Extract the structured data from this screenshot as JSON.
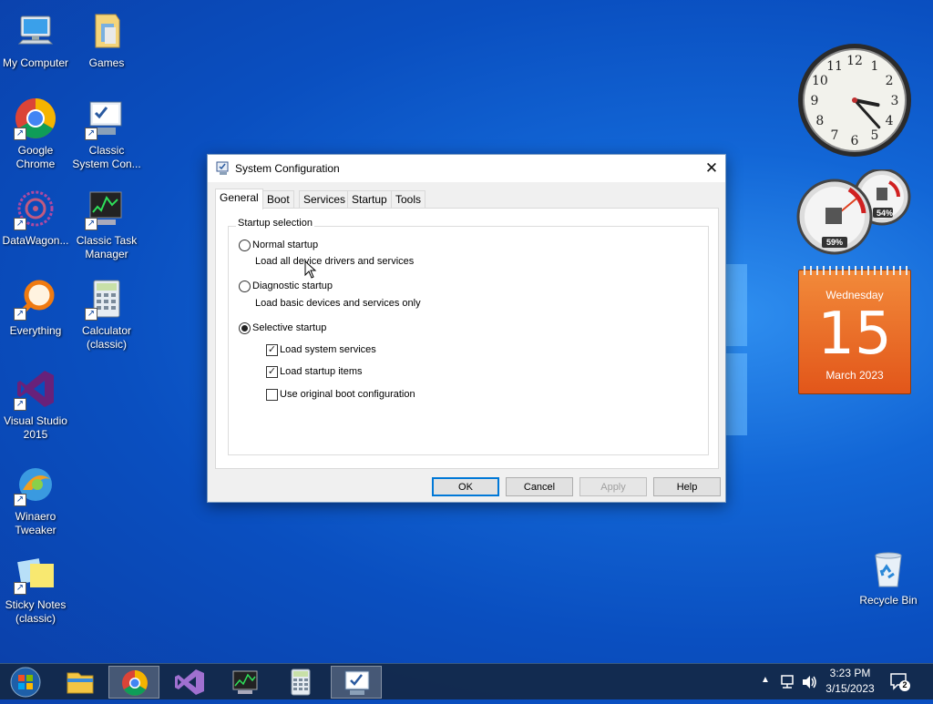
{
  "desktop": {
    "icons": [
      {
        "label": "My Computer"
      },
      {
        "label": "Games"
      },
      {
        "label": "Google Chrome"
      },
      {
        "label": "Classic System Con..."
      },
      {
        "label": "DataWagon..."
      },
      {
        "label": "Classic Task Manager"
      },
      {
        "label": "Everything"
      },
      {
        "label": "Calculator (classic)"
      },
      {
        "label": "Visual Studio 2015"
      },
      {
        "label": "Winaero Tweaker"
      },
      {
        "label": "Sticky Notes (classic)"
      },
      {
        "label": "Recycle Bin"
      }
    ]
  },
  "dialog": {
    "title": "System Configuration",
    "close_glyph": "✕",
    "tabs": [
      {
        "label": "General",
        "active": true
      },
      {
        "label": "Boot"
      },
      {
        "label": "Services"
      },
      {
        "label": "Startup"
      },
      {
        "label": "Tools"
      }
    ],
    "group_title": "Startup selection",
    "options": {
      "normal": {
        "label": "Normal startup",
        "desc": "Load all device drivers and services",
        "selected": false
      },
      "diagnostic": {
        "label": "Diagnostic startup",
        "desc": "Load basic devices and services only",
        "selected": false
      },
      "selective": {
        "label": "Selective startup",
        "selected": true
      }
    },
    "checks": {
      "system_services": {
        "label": "Load system services",
        "checked": true
      },
      "startup_items": {
        "label": "Load startup items",
        "checked": true
      },
      "original_boot": {
        "label": "Use original boot configuration",
        "checked": false
      }
    },
    "check_glyph": "✓",
    "buttons": {
      "ok": "OK",
      "cancel": "Cancel",
      "apply": "Apply",
      "help": "Help"
    }
  },
  "gadgets": {
    "clock": {
      "hour": 3,
      "minute": 23,
      "numerals": [
        "12",
        "1",
        "2",
        "3",
        "4",
        "5",
        "6",
        "7",
        "8",
        "9",
        "10",
        "11"
      ]
    },
    "meter": {
      "cpu": "59%",
      "memory": "54%"
    },
    "calendar": {
      "weekday": "Wednesday",
      "day": "15",
      "month": "March 2023"
    }
  },
  "taskbar": {
    "time": "3:23 PM",
    "date": "3/15/2023",
    "notification_count": "2",
    "tray_arrow": "▲"
  },
  "colors": {
    "accent": "#0078d7",
    "calendar": "#e8641f"
  }
}
